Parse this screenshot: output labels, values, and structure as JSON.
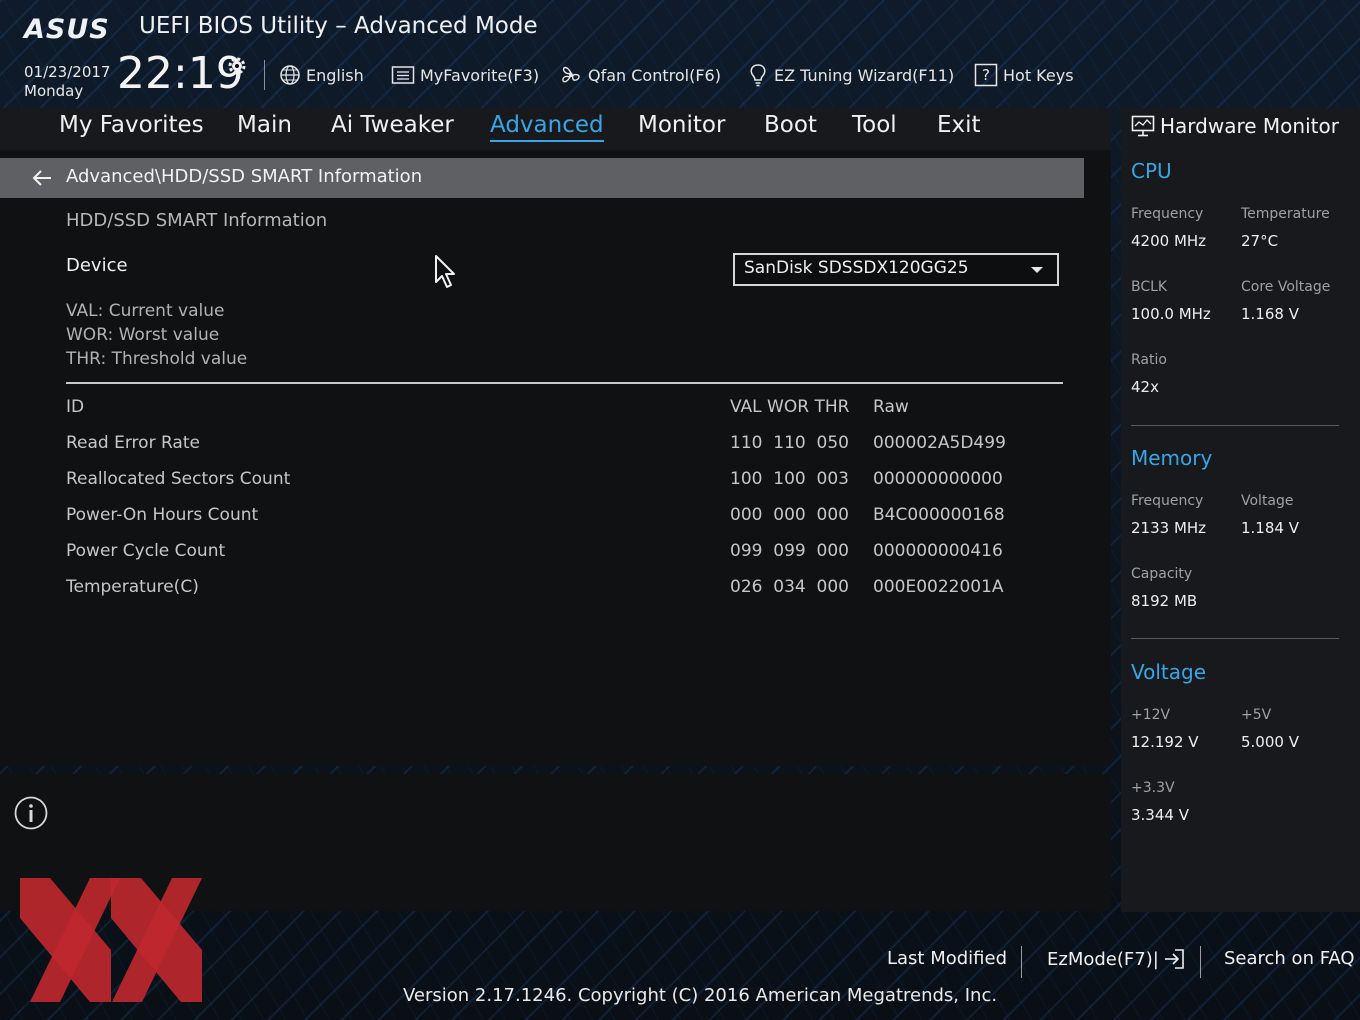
{
  "header": {
    "brand": "ASUS",
    "title": "UEFI BIOS Utility – Advanced Mode",
    "date": "01/23/2017",
    "day": "Monday",
    "time": "22:19",
    "tools": {
      "language": "English",
      "myfavorite": "MyFavorite(F3)",
      "qfan": "Qfan Control(F6)",
      "ez_tuning": "EZ Tuning Wizard(F11)",
      "hotkeys": "Hot Keys"
    }
  },
  "menu": {
    "favorites": "My Favorites",
    "main": "Main",
    "ai_tweaker": "Ai Tweaker",
    "advanced": "Advanced",
    "monitor": "Monitor",
    "boot": "Boot",
    "tool": "Tool",
    "exit": "Exit",
    "active": "advanced"
  },
  "page": {
    "breadcrumb": "Advanced\\HDD/SSD SMART Information",
    "section_title": "HDD/SSD SMART Information",
    "device_label": "Device",
    "device_value": "SanDisk SDSSDX120GG25",
    "legend": [
      "VAL:  Current value",
      "WOR: Worst value",
      "THR:  Threshold value"
    ],
    "table": {
      "col_id": "ID",
      "col_vals": "VAL WOR THR",
      "col_raw": "Raw",
      "rows": [
        {
          "name": "Read Error Rate",
          "vals": "110  110  050",
          "raw": "000002A5D499"
        },
        {
          "name": "Reallocated Sectors Count",
          "vals": "100  100  003",
          "raw": "000000000000"
        },
        {
          "name": "Power-On Hours Count",
          "vals": "000  000  000",
          "raw": "B4C000000168"
        },
        {
          "name": "Power Cycle Count",
          "vals": "099  099  000",
          "raw": "000000000416"
        },
        {
          "name": "Temperature(C)",
          "vals": "026  034  000",
          "raw": "000E0022001A"
        }
      ]
    }
  },
  "hwmon": {
    "title": "Hardware Monitor",
    "cpu": {
      "title": "CPU",
      "freq_label": "Frequency",
      "freq": "4200 MHz",
      "temp_label": "Temperature",
      "temp": "27°C",
      "bclk_label": "BCLK",
      "bclk": "100.0 MHz",
      "vcore_label": "Core Voltage",
      "vcore": "1.168 V",
      "ratio_label": "Ratio",
      "ratio": "42x"
    },
    "memory": {
      "title": "Memory",
      "freq_label": "Frequency",
      "freq": "2133 MHz",
      "volt_label": "Voltage",
      "volt": "1.184 V",
      "cap_label": "Capacity",
      "cap": "8192 MB"
    },
    "voltage": {
      "title": "Voltage",
      "v12_label": "+12V",
      "v12": "12.192 V",
      "v5_label": "+5V",
      "v5": "5.000 V",
      "v33_label": "+3.3V",
      "v33": "3.344 V"
    }
  },
  "footer": {
    "last_modified": "Last Modified",
    "ezmode": "EzMode(F7)|",
    "search_faq": "Search on FAQ",
    "version": "Version 2.17.1246. Copyright (C) 2016 American Megatrends, Inc."
  },
  "colors": {
    "accent": "#38a6e6",
    "watermark_red": "#c0282d"
  }
}
